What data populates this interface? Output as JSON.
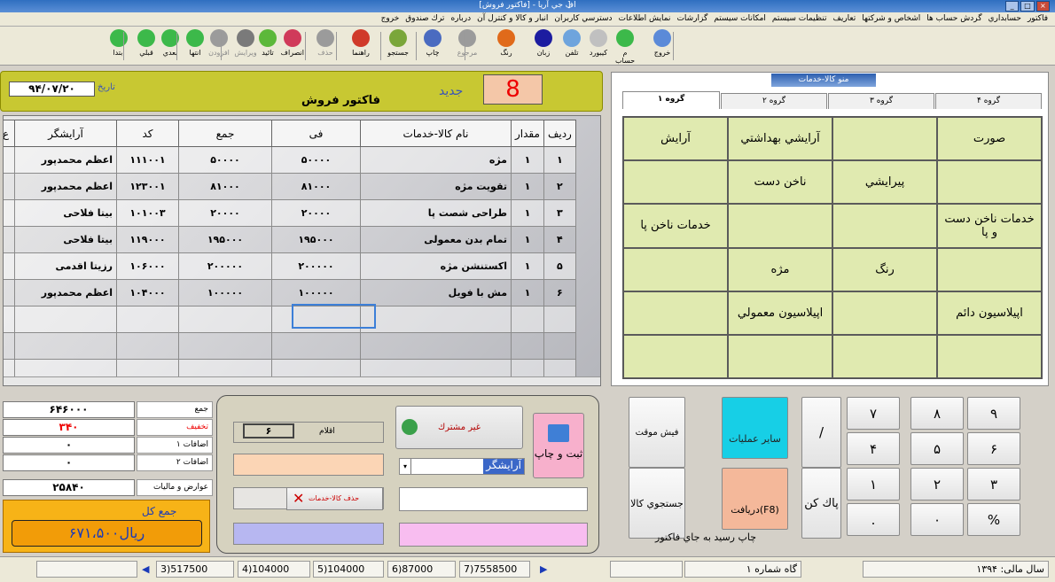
{
  "window": {
    "title": "اف جي آريا - [فاكتور فروش]",
    "bracket": "]"
  },
  "menu": [
    "فاكتور",
    "حسابداري",
    "گردش حساب ها",
    "اشخاص و شركتها",
    "تعاريف",
    "تنظيمات سيستم",
    "امكانات سيستم",
    "گزارشات",
    "نمايش اطلاعات",
    "دسترسي كاربران",
    "انبار و كالا و كنترل آن",
    "درباره",
    "ترك صندوق",
    "خروج"
  ],
  "toolbar": {
    "right": [
      {
        "label": "خروج",
        "color": "#5b8ad8"
      },
      {
        "label": "م حساب",
        "color": "#3cb94a"
      },
      {
        "label": "كيبورد",
        "color": "#c0c0c0"
      },
      {
        "label": "تلفن",
        "color": "#6ea4dd"
      },
      {
        "label": "زبان",
        "color": "#1c1ca0"
      },
      {
        "label": "رنگ",
        "color": "#e06a1a"
      },
      {
        "label": "مرجوع",
        "color": "#9b9b9b",
        "disabled": true
      },
      {
        "label": "چاپ",
        "color": "#4a6bc0"
      },
      {
        "label": "جستجو",
        "color": "#7aa63a"
      },
      {
        "label": "راهنما",
        "color": "#d03a2a"
      },
      {
        "label": "حذف",
        "color": "#9b9b9b",
        "disabled": true
      },
      {
        "label": "انصراف",
        "color": "#d03a5a"
      },
      {
        "label": "تائيد",
        "color": "#5cb83a"
      },
      {
        "label": "ويرايش",
        "color": "#7a7a7a",
        "disabled": true
      },
      {
        "label": "افزودن",
        "color": "#9b9b9b",
        "disabled": true
      },
      {
        "label": "انتها",
        "color": "#3cb94a"
      },
      {
        "label": "بعدي",
        "color": "#3cb94a"
      },
      {
        "label": "قبلي",
        "color": "#3cb94a"
      },
      {
        "label": "ابتدا",
        "color": "#3cb94a"
      }
    ]
  },
  "invoice": {
    "title": "فاكتور فروش",
    "new_label": "جديد",
    "number": "8",
    "date_label": "تاريخ",
    "date": "۹۴/۰۷/۲۰"
  },
  "grid": {
    "headers": [
      "رديف",
      "مقدار",
      "نام كالا-خدمات",
      "فی",
      "جمع",
      "كد",
      "آرايشگر",
      "ع"
    ],
    "rows": [
      [
        "١",
        "١",
        "مژه",
        "۵۰۰۰۰",
        "۵۰۰۰۰",
        "۱۱۱۰۰۱",
        "اعظم  محمدپور"
      ],
      [
        "٢",
        "١",
        "تقويت مژه",
        "۸۱۰۰۰",
        "۸۱۰۰۰",
        "۱۲۳۰۰۱",
        "اعظم  محمدپور"
      ],
      [
        "٣",
        "١",
        "طراحی شصت پا",
        "۲۰۰۰۰",
        "۲۰۰۰۰",
        "۱۰۱۰۰۳",
        "بيتا  فلاحی"
      ],
      [
        "۴",
        "١",
        "تمام بدن معمولی",
        "۱۹۵۰۰۰",
        "۱۹۵۰۰۰",
        "۱۱۹۰۰۰",
        "بيتا  فلاحی"
      ],
      [
        "۵",
        "١",
        "اكستنشن مژه",
        "۲۰۰۰۰۰",
        "۲۰۰۰۰۰",
        "۱۰۶۰۰۰",
        "رزيتا  اقدمی"
      ],
      [
        "۶",
        "١",
        "مش با فويل",
        "۱۰۰۰۰۰",
        "۱۰۰۰۰۰",
        "۱۰۴۰۰۰",
        "اعظم  محمدپور"
      ]
    ]
  },
  "groups": {
    "title": "منو كالا-خدمات",
    "tabs": [
      "گروه ۱",
      "گروه ۲",
      "گروه ۳",
      "گروه ۴"
    ],
    "cells": [
      "صورت",
      "",
      "آرايشي بهداشتي",
      "آرايش",
      "",
      "پيرايشي",
      "ناخن دست",
      "",
      "خدمات ناخن دست و پا",
      "",
      "",
      "خدمات ناخن پا",
      "",
      "رنگ",
      "مژه",
      "",
      "اپيلاسيون دائم",
      "",
      "اپيلاسيون معمولي",
      ""
    ]
  },
  "totals": {
    "sum_label": "جمع",
    "sum": "۶۴۶۰۰۰",
    "discount_label": "تخفيف",
    "discount": "۳۴۰",
    "add1_label": "اضافات ۱",
    "add1": "۰",
    "add2_label": "اضافات ۲",
    "add2": "۰",
    "tax_label": "عوارض و ماليات",
    "tax": "۲۵۸۴۰",
    "grand_label": "جمع  كل",
    "grand": "۶۷۱،۵۰۰ريال"
  },
  "mid": {
    "items_label": "اقلام",
    "items": "۶",
    "customer_button": "غير مشترك",
    "register_button": "ثبت و چاپ",
    "barber_select": "آرايشگر",
    "delete_button": "حذف كالا-خدمات"
  },
  "calc": {
    "keys": [
      "٩",
      "٨",
      "٧",
      "۶",
      "۵",
      "۴",
      "٣",
      "٢",
      "١",
      "%",
      "٠",
      "."
    ],
    "slash": "/",
    "clear": "پاك كن",
    "temp": "فيش موقت",
    "other": "ساير عمليات",
    "search": "جستجوي كالا",
    "receive": "دريافت(F8)",
    "print_check": "چاپ رسيد به جاي فاكتور"
  },
  "status": {
    "pages": [
      "3)517500",
      "4)104000",
      "5)104000",
      "6)87000",
      "7)7558500"
    ],
    "station": "گاه شماره ١",
    "fiscal": "سال مالی: ١٣٩۴"
  }
}
